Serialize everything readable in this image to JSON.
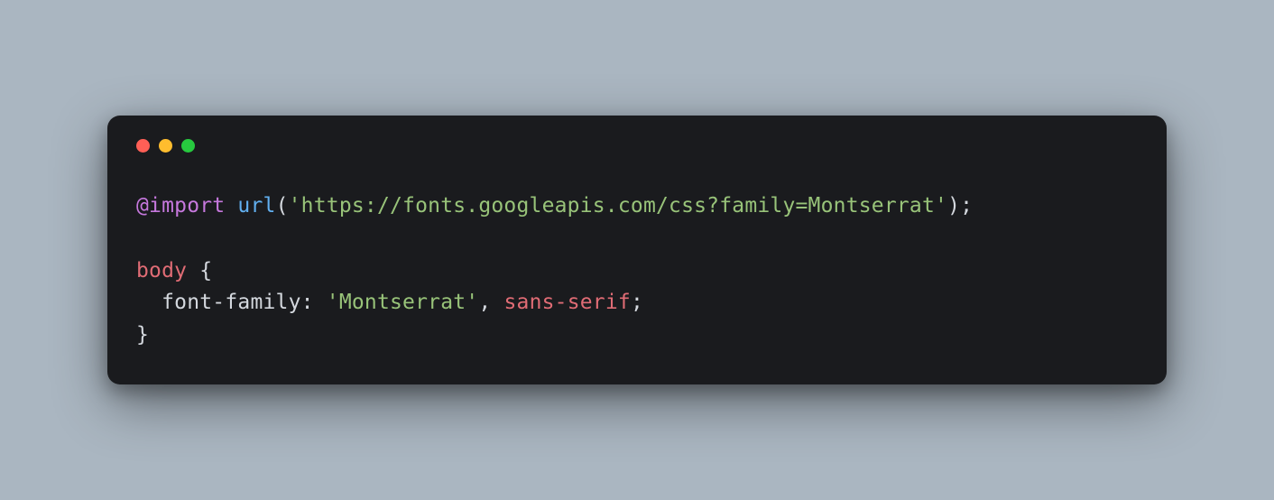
{
  "window": {
    "dots": [
      "red",
      "yellow",
      "green"
    ]
  },
  "code": {
    "line1": {
      "at_import": "@import",
      "space1": " ",
      "url_func": "url",
      "open_paren": "(",
      "url_string": "'https://fonts.googleapis.com/css?family=Montserrat'",
      "close_paren": ")",
      "semicolon": ";"
    },
    "blank": "",
    "line3": {
      "selector": "body",
      "space": " ",
      "open_brace": "{"
    },
    "line4": {
      "indent": "  ",
      "property": "font-family",
      "colon": ":",
      "space": " ",
      "value_string": "'Montserrat'",
      "comma": ",",
      "space2": " ",
      "value_keyword": "sans-serif",
      "semicolon": ";"
    },
    "line5": {
      "close_brace": "}"
    }
  },
  "colors": {
    "background": "#aab6c1",
    "window_bg": "#1a1b1e",
    "red": "#ff5f56",
    "yellow": "#ffbd2e",
    "green": "#27c93f",
    "at_rule": "#c678dd",
    "function": "#61afef",
    "string": "#98c379",
    "selector": "#e06c75",
    "default": "#d4d8de"
  }
}
